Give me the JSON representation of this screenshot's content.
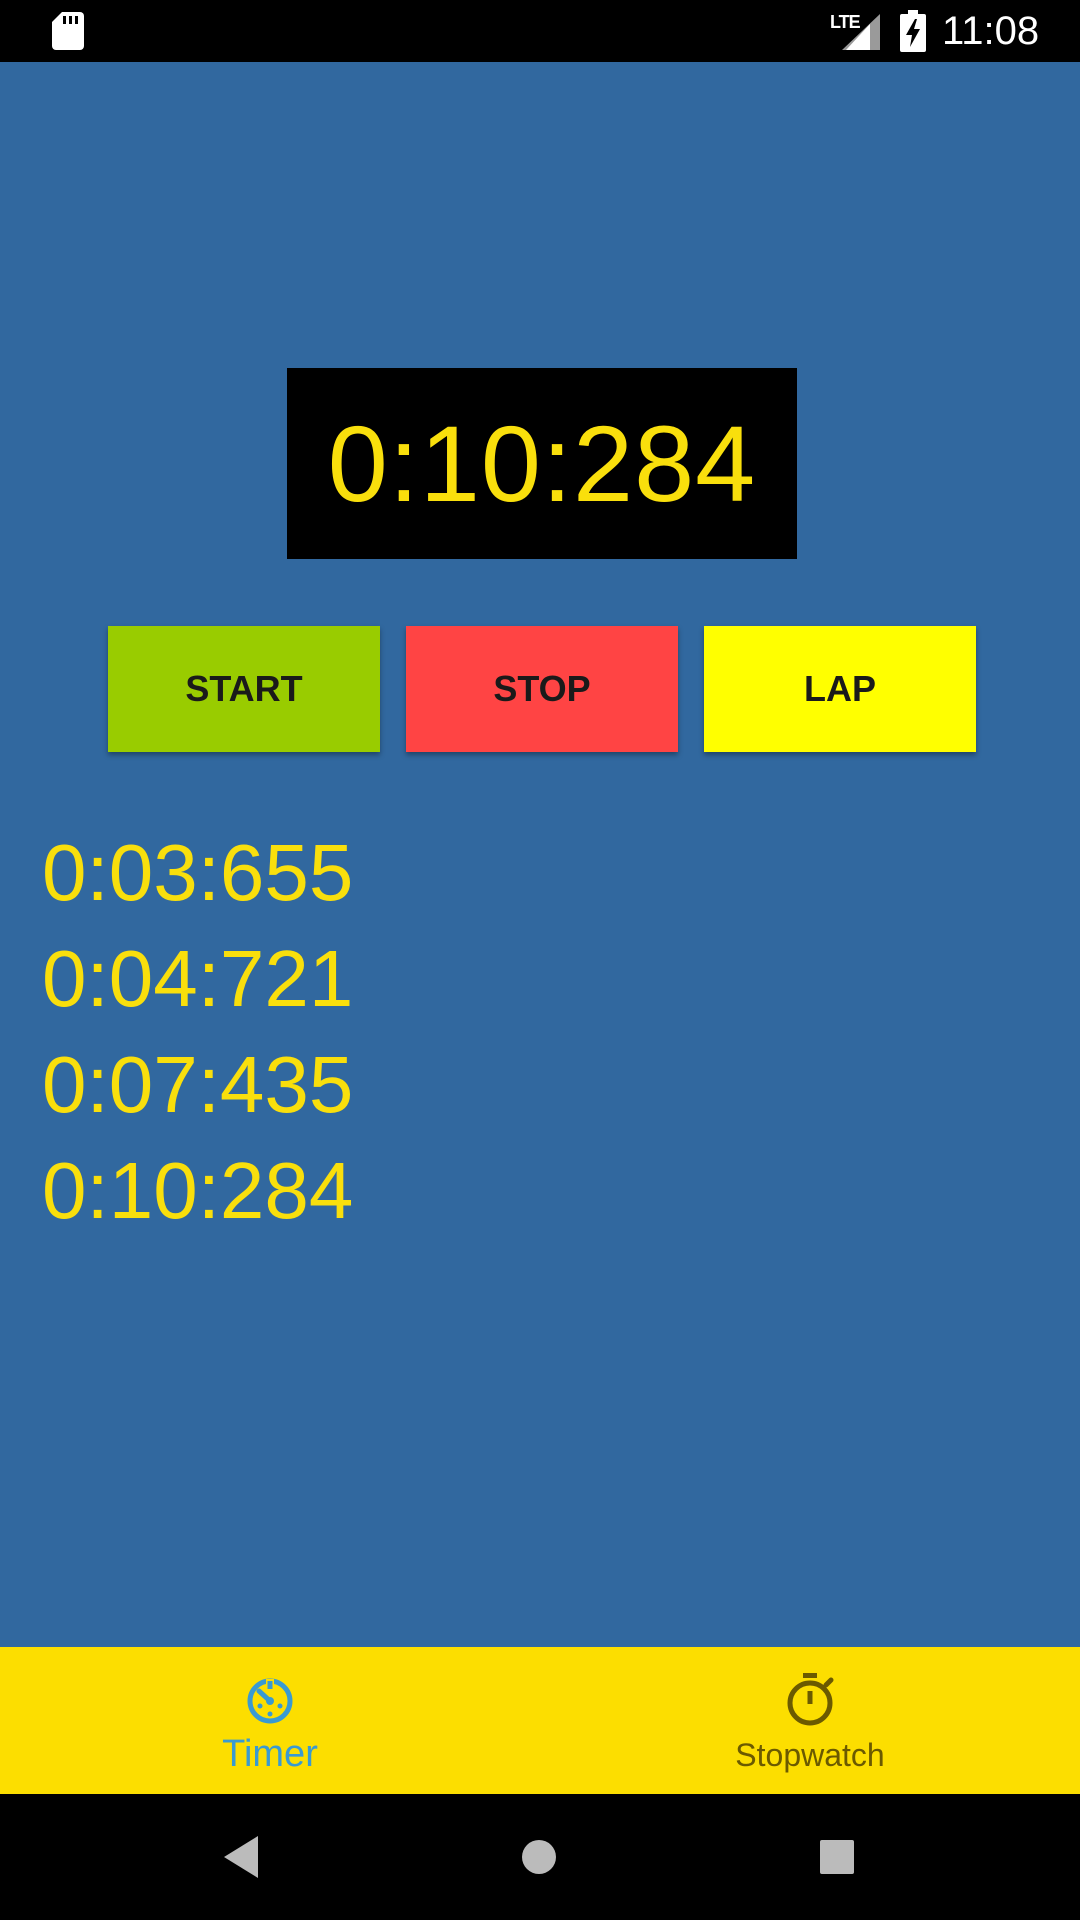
{
  "status_bar": {
    "network": "LTE",
    "time": "11:08",
    "icons": [
      "sd-card-icon",
      "signal-icon",
      "battery-charging-icon"
    ]
  },
  "timer": {
    "value": "0:10:284"
  },
  "buttons": {
    "start": "START",
    "stop": "STOP",
    "lap": "LAP"
  },
  "laps": [
    "0:03:655",
    "0:04:721",
    "0:07:435",
    "0:10:284"
  ],
  "bottom_nav": {
    "items": [
      {
        "label": "Timer",
        "icon": "timer-icon",
        "active": true
      },
      {
        "label": "Stopwatch",
        "icon": "stopwatch-icon",
        "active": false
      }
    ]
  },
  "system_nav": {
    "icons": [
      "back-icon",
      "home-icon",
      "recents-icon"
    ]
  },
  "colors": {
    "background": "#31689f",
    "digits": "#f9df0c",
    "start": "#99cc00",
    "stop": "#ff4444",
    "lap": "#ffff00",
    "bottom_nav": "#fcde00",
    "active_nav": "#3a9ad1"
  }
}
